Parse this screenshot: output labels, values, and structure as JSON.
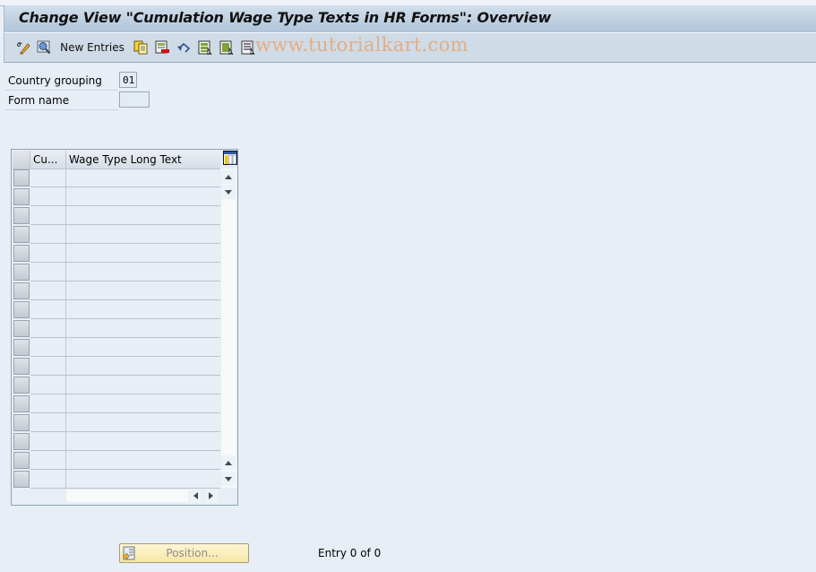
{
  "window": {
    "title": "Change View \"Cumulation Wage Type Texts in HR Forms\": Overview"
  },
  "toolbar": {
    "items": [
      {
        "name": "display-change-toggle",
        "icon": "pencil-glasses-icon"
      },
      {
        "name": "details",
        "icon": "magnifier-icon"
      },
      {
        "name": "new-entries",
        "label": "New Entries"
      },
      {
        "name": "copy-as",
        "icon": "copy-icon"
      },
      {
        "name": "delete",
        "icon": "delete-row-icon"
      },
      {
        "name": "undo-change",
        "icon": "undo-icon"
      },
      {
        "name": "select-all",
        "icon": "select-all-icon"
      },
      {
        "name": "select-block",
        "icon": "select-block-icon"
      },
      {
        "name": "deselect-all",
        "icon": "deselect-all-icon"
      }
    ],
    "watermark": "www.tutorialkart.com"
  },
  "fields": {
    "country_grouping": {
      "label": "Country grouping",
      "value": "01"
    },
    "form_name": {
      "label": "Form name",
      "value": ""
    }
  },
  "table": {
    "columns": [
      {
        "key": "cumulation",
        "label": "Cu..."
      },
      {
        "key": "long_text",
        "label": "Wage Type Long Text"
      }
    ],
    "visible_rows": 17,
    "rows": []
  },
  "footer": {
    "position_button": "Position...",
    "entry_info": "Entry 0 of 0"
  },
  "colors": {
    "title_bar": "#b0c4da",
    "toolbar": "#cfdbe6",
    "background": "#e8eef5",
    "watermark": "#e6a97a",
    "position_button": "#f7e7a6"
  }
}
